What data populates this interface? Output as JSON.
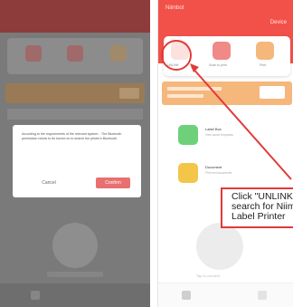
{
  "left_panel": {
    "dialog": {
      "message": "According to the requirements of the relevant system... The Bluetooth permission needs to be turned on to search the printer's Bluetooth.",
      "cancel_label": "Cancel",
      "confirm_label": "Confirm"
    }
  },
  "right_panel": {
    "header": {
      "title": "Niimbot",
      "right_label": "Device"
    },
    "tools": [
      {
        "label": "UNLINK"
      },
      {
        "label": "Scan to print"
      },
      {
        "label": "Print"
      }
    ],
    "list": [
      {
        "title": "Label Box",
        "subtitle": "View saved templates",
        "color": "#6fd07a"
      },
      {
        "title": "Document",
        "subtitle": "Print text documents",
        "color": "#f3c64a"
      }
    ],
    "circle_label": "Tap to connect"
  },
  "callout": {
    "lines": [
      "Click \"UNLINK\" to",
      "search for Niimbot",
      "Label Printer"
    ]
  },
  "colors": {
    "brand_red": "#f2514a",
    "callout_red": "#e23a3a",
    "banner_orange": "#f5b77c"
  }
}
